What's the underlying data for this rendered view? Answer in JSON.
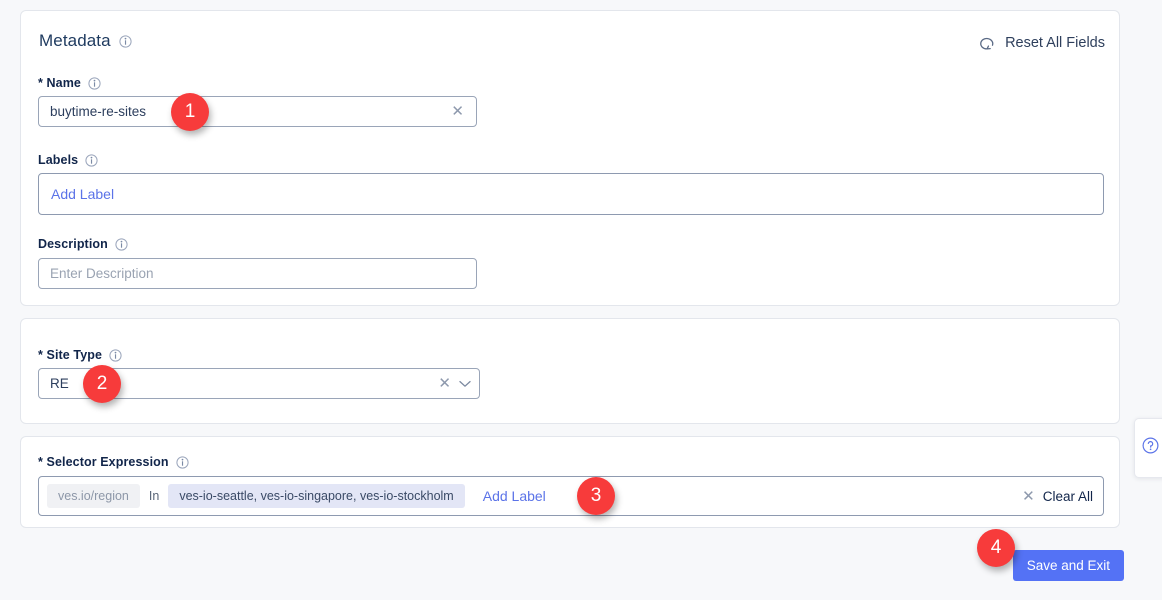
{
  "metadata_card": {
    "title": "Metadata",
    "title_info_icon": "info-icon",
    "reset_label": "Reset All Fields",
    "reset_icon": "reset-arrow-icon",
    "name_field": {
      "label": "* Name",
      "value": "buytime-re-sites",
      "clear_icon": "close-icon"
    },
    "labels_field": {
      "label": "Labels",
      "add_label_link": "Add Label"
    },
    "description_field": {
      "label": "Description",
      "placeholder": "Enter Description"
    }
  },
  "sitetype_card": {
    "label": "* Site Type",
    "value": "RE",
    "clear_icon": "close-icon",
    "dropdown_icon": "chevron-down-icon"
  },
  "selector_card": {
    "label": "* Selector Expression",
    "expression": {
      "key": "ves.io/region",
      "operator": "In",
      "values": "ves-io-seattle, ves-io-singapore, ves-io-stockholm"
    },
    "add_label_link": "Add Label",
    "clear_all_label": "Clear All",
    "clear_all_icon": "close-icon"
  },
  "footer": {
    "save_label": "Save and Exit"
  },
  "help_tab": {
    "icon": "help-circle-icon"
  },
  "badges": {
    "one": "1",
    "two": "2",
    "three": "3",
    "four": "4"
  },
  "colors": {
    "accent_blue": "#5472f5",
    "link_blue": "#5b73e8",
    "badge_red": "#f73b3b",
    "page_bg": "#f7f8fa",
    "title_navy": "#1e3a5f"
  }
}
